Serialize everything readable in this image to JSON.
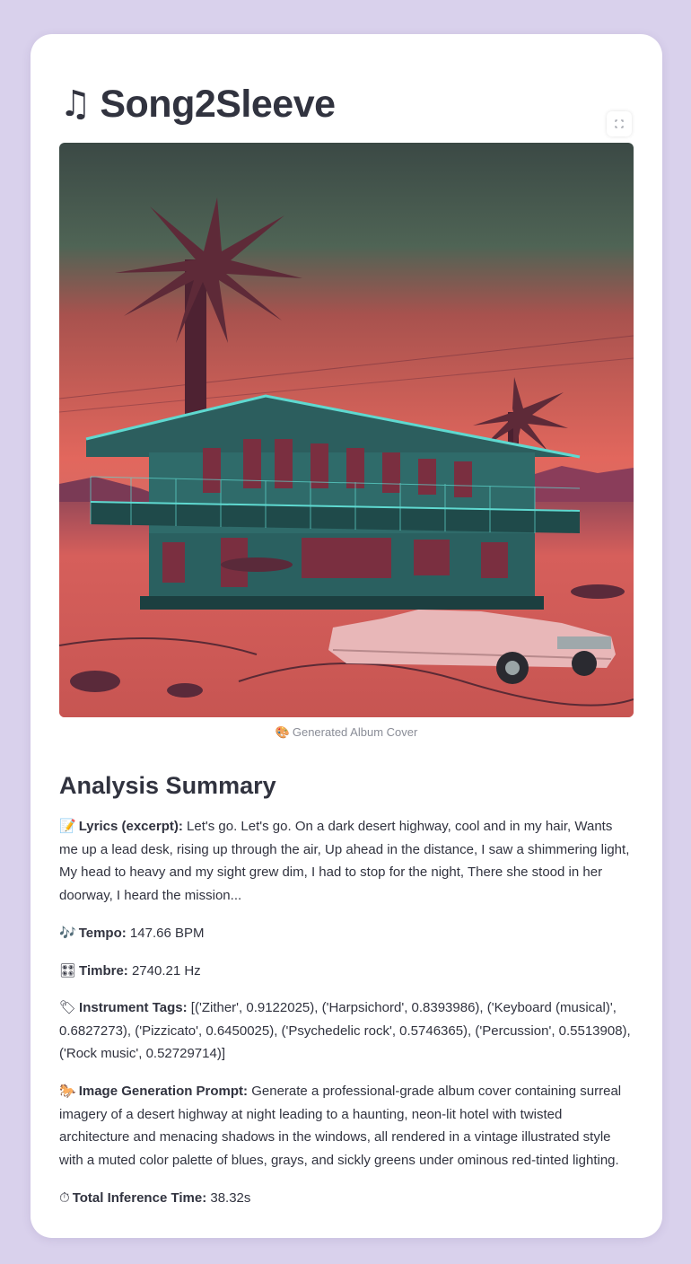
{
  "app": {
    "title_icon": "music-note-icon",
    "title": "Song2Sleeve"
  },
  "image": {
    "caption_icon": "palette-icon",
    "caption": "Generated Album Cover",
    "fullscreen_icon": "expand-icon",
    "colors": {
      "sky_top": "#3c4a45",
      "sky_bottom": "#e0655c",
      "ground": "#d9605c",
      "building": "#2f6b6a",
      "neon": "#5fd9d0",
      "palm": "#5e2a38",
      "car": "#e8b7b8"
    }
  },
  "summary": {
    "heading": "Analysis Summary",
    "lyrics": {
      "icon": "memo-icon",
      "label": "Lyrics (excerpt):",
      "value": "Let's go. Let's go. On a dark desert highway, cool and in my hair, Wants me up a lead desk, rising up through the air, Up ahead in the distance, I saw a shimmering light, My head to heavy and my sight grew dim, I had to stop for the night, There she stood in her doorway, I heard the mission..."
    },
    "tempo": {
      "icon": "music-notes-icon",
      "label": "Tempo:",
      "value": "147.66 BPM"
    },
    "timbre": {
      "icon": "control-knobs-icon",
      "label": "Timbre:",
      "value": "2740.21 Hz"
    },
    "instruments": {
      "icon": "tag-icon",
      "label": "Instrument Tags:",
      "value": "[('Zither', 0.9122025), ('Harpsichord', 0.8393986), ('Keyboard (musical)', 0.6827273), ('Pizzicato', 0.6450025), ('Psychedelic rock', 0.5746365), ('Percussion', 0.5513908), ('Rock music', 0.52729714)]"
    },
    "prompt": {
      "icon": "horse-icon",
      "label": "Image Generation Prompt:",
      "value": "Generate a professional-grade album cover containing surreal imagery of a desert highway at night leading to a haunting, neon-lit hotel with twisted architecture and menacing shadows in the windows, all rendered in a vintage illustrated style with a muted color palette of blues, grays, and sickly greens under ominous red-tinted lighting."
    },
    "time": {
      "icon": "stopwatch-icon",
      "label": "Total Inference Time:",
      "value": "38.32s"
    }
  }
}
